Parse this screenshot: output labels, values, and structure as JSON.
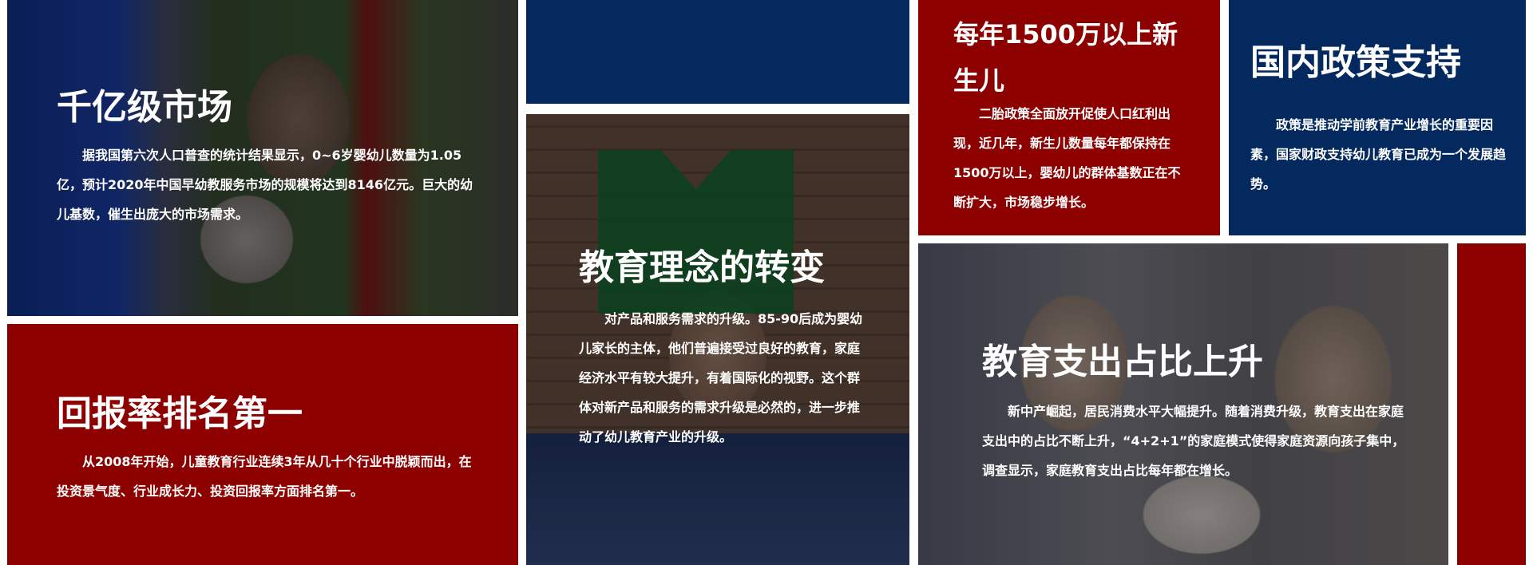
{
  "tiles": {
    "market": {
      "title": "千亿级市场",
      "body": "据我国第六次人口普查的统计结果显示，0~6岁婴幼儿数量为1.05亿，预计2020年中国早幼教服务市场的规模将达到8146亿元。巨大的幼儿基数，催生出庞大的市场需求。"
    },
    "return": {
      "title": "回报率排名第一",
      "body": "从2008年开始，儿童教育行业连续3年从几十个行业中脱颖而出，在投资景气度、行业成长力、投资回报率方面排名第一。"
    },
    "concept": {
      "title": "教育理念的转变",
      "body": "对产品和服务需求的升级。85-90后成为婴幼儿家长的主体，他们普遍接受过良好的教育，家庭经济水平有较大提升，有着国际化的视野。这个群体对新产品和服务的需求升级是必然的，进一步推动了幼儿教育产业的升级。"
    },
    "births": {
      "title": "每年1500万以上新生儿",
      "body": "二胎政策全面放开促使人口红利出现，近几年，新生儿数量每年都保持在1500万以上，婴幼儿的群体基数正在不断扩大，市场稳步增长。"
    },
    "policy": {
      "title": "国内政策支持",
      "body": "政策是推动学前教育产业增长的重要因素，国家财政支持幼儿教育已成为一个发展趋势。"
    },
    "spending": {
      "title": "教育支出占比上升",
      "body": "新中产崛起，居民消费水平大幅提升。随着消费升级，教育支出在家庭支出中的占比不断上升，“4+2+1”的家庭模式使得家庭资源向孩子集中，调查显示，家庭教育支出占比每年都在增长。"
    }
  },
  "colors": {
    "navy": "#04295e",
    "red": "#8c0000"
  }
}
